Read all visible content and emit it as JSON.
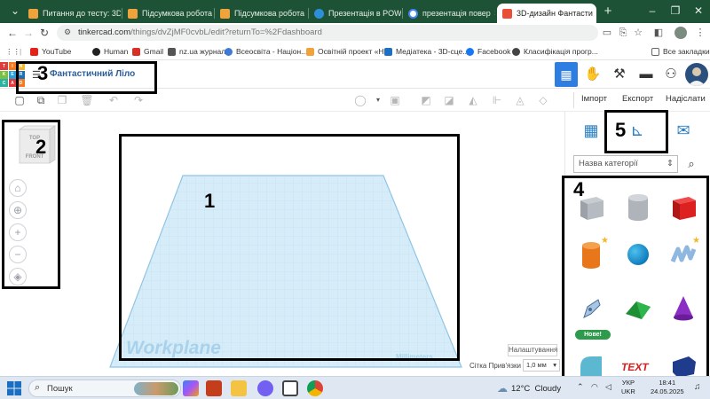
{
  "browser": {
    "tabs": [
      {
        "label": "Питання до тесту: 3D",
        "favicon_color": "#f0a33a"
      },
      {
        "label": "Підсумкова робота",
        "favicon_color": "#f0a33a"
      },
      {
        "label": "Підсумкова робота",
        "favicon_color": "#f0a33a"
      },
      {
        "label": "Презентація в POWE",
        "favicon_color": "#2d8fd9"
      },
      {
        "label": "презентація повер",
        "favicon_color": "#4285f4"
      },
      {
        "label": "3D-дизайн Фантасти",
        "favicon_color": "#e94f37"
      }
    ],
    "close_glyph": "×",
    "new_tab_glyph": "+",
    "window_controls": [
      "⌄",
      "–",
      "❐",
      "✕"
    ],
    "address": {
      "host": "tinkercad.com",
      "path": "/things/dvZjMF0cvbL/edit?returnTo=%2Fdashboard"
    },
    "bookmarks": [
      {
        "label": "YouTube",
        "color": "#e62117"
      },
      {
        "label": "Human",
        "color": "#222222"
      },
      {
        "label": "Gmail",
        "color": "#d93025"
      },
      {
        "label": "nz.ua журнал",
        "color": "#555555"
      },
      {
        "label": "Всеосвіта - Націон...",
        "color": "#3e7bd6"
      },
      {
        "label": "Освітній проект «Н...",
        "color": "#f0a33a"
      },
      {
        "label": "Медіатека - 3D-сце...",
        "color": "#1e6fc3"
      },
      {
        "label": "Facebook",
        "color": "#1877f2"
      },
      {
        "label": "Класифікація прогр...",
        "color": "#444444"
      }
    ],
    "all_bookmarks": "Все закладки"
  },
  "tinkercad": {
    "logo_letters": [
      "T",
      "I",
      "N",
      "K",
      "E",
      "R",
      "C",
      "A",
      "D"
    ],
    "design_title": "Фантастичний Ліло",
    "actions": {
      "import": "Імпорт",
      "export": "Експорт",
      "send": "Надіслати"
    },
    "category_select": "Назва категорії",
    "new_badge": "Нове!",
    "view_cube": {
      "top": "TOP",
      "front": "FRONT"
    },
    "workplane_label": "Workplane",
    "units_label": "Millimeters",
    "settings_button": "Налаштування",
    "snap_label": "Сітка Прив'язки",
    "snap_value": "1,0 мм",
    "accent_color": "#2e7de1"
  },
  "annotations": [
    "1",
    "2",
    "3",
    "4",
    "5"
  ],
  "taskbar": {
    "search_placeholder": "Пошук",
    "weather_temp": "12°C",
    "weather_text": "Cloudy",
    "lang_top": "УКР",
    "lang_bottom": "UKR",
    "time": "18:41",
    "date": "24.05.2025"
  }
}
